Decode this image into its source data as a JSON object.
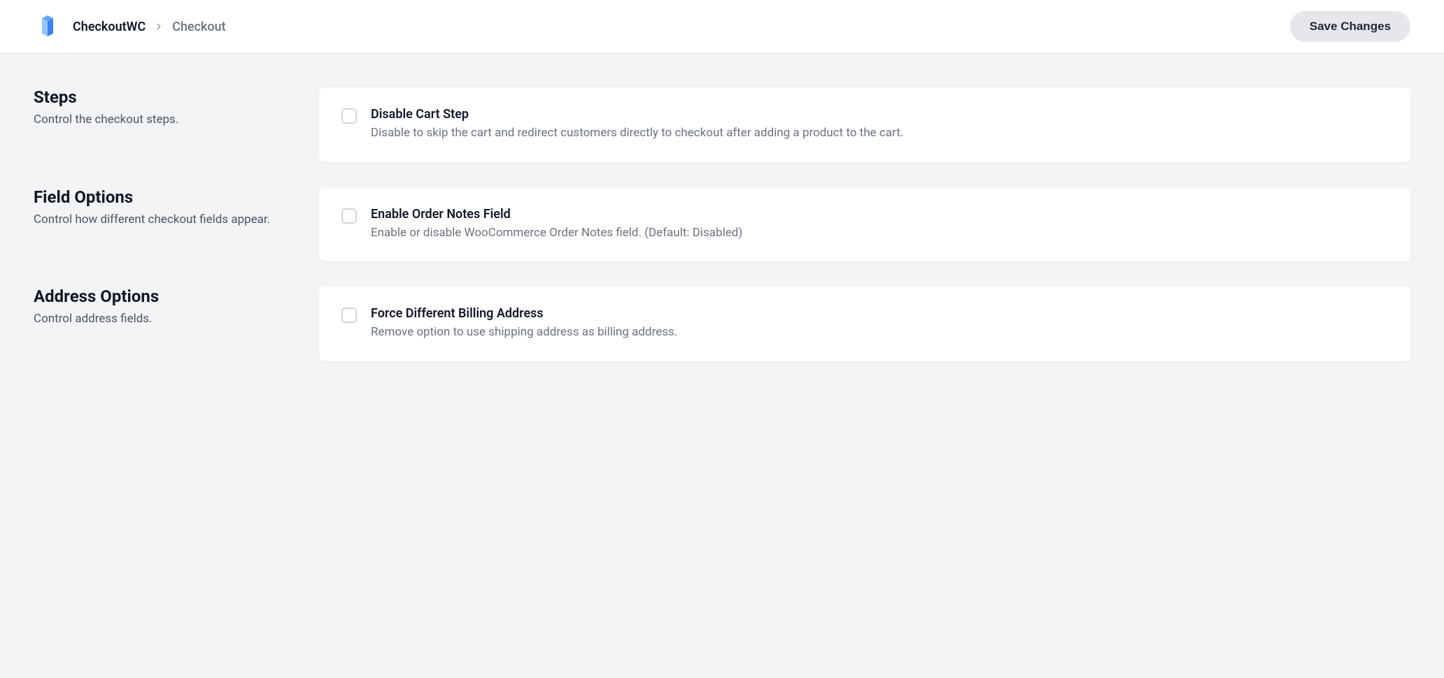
{
  "header": {
    "breadcrumb": {
      "root": "CheckoutWC",
      "current": "Checkout"
    },
    "save_button": "Save Changes"
  },
  "sections": {
    "steps": {
      "title": "Steps",
      "description": "Control the checkout steps.",
      "option": {
        "title": "Disable Cart Step",
        "description": "Disable to skip the cart and redirect customers directly to checkout after adding a product to the cart."
      }
    },
    "field_options": {
      "title": "Field Options",
      "description": "Control how different checkout fields appear.",
      "option": {
        "title": "Enable Order Notes Field",
        "description": "Enable or disable WooCommerce Order Notes field. (Default: Disabled)"
      }
    },
    "address_options": {
      "title": "Address Options",
      "description": "Control address fields.",
      "option": {
        "title": "Force Different Billing Address",
        "description": "Remove option to use shipping address as billing address."
      }
    }
  }
}
